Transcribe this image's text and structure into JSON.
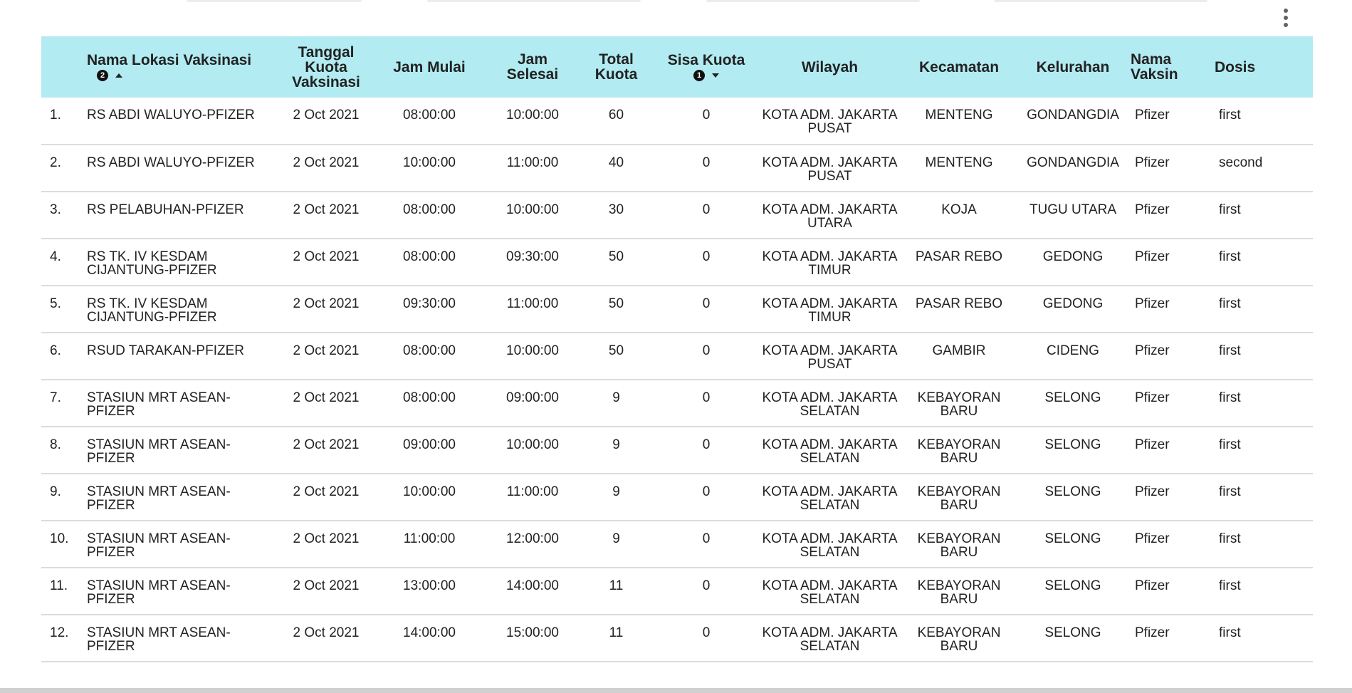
{
  "table": {
    "columns": {
      "nama_lokasi": "Nama Lokasi Vaksinasi",
      "nama_lokasi_sort_order": "2",
      "tanggal": "Tanggal Kuota Vaksinasi",
      "jam_mulai": "Jam Mulai",
      "jam_selesai": "Jam Selesai",
      "total_kuota": "Total Kuota",
      "sisa_kuota": "Sisa Kuota",
      "sisa_kuota_sort_order": "1",
      "wilayah": "Wilayah",
      "kecamatan": "Kecamatan",
      "kelurahan": "Kelurahan",
      "nama_vaksin": "Nama Vaksin",
      "dosis": "Dosis"
    },
    "rows": [
      {
        "no": "1.",
        "lokasi": "RS ABDI WALUYO-PFIZER",
        "tanggal": "2 Oct 2021",
        "mulai": "08:00:00",
        "selesai": "10:00:00",
        "total": "60",
        "sisa": "0",
        "wilayah": "KOTA ADM. JAKARTA PUSAT",
        "kecamatan": "MENTENG",
        "kelurahan": "GONDANGDIA",
        "vaksin": "Pfizer",
        "dosis": "first"
      },
      {
        "no": "2.",
        "lokasi": "RS ABDI WALUYO-PFIZER",
        "tanggal": "2 Oct 2021",
        "mulai": "10:00:00",
        "selesai": "11:00:00",
        "total": "40",
        "sisa": "0",
        "wilayah": "KOTA ADM. JAKARTA PUSAT",
        "kecamatan": "MENTENG",
        "kelurahan": "GONDANGDIA",
        "vaksin": "Pfizer",
        "dosis": "second"
      },
      {
        "no": "3.",
        "lokasi": "RS PELABUHAN-PFIZER",
        "tanggal": "2 Oct 2021",
        "mulai": "08:00:00",
        "selesai": "10:00:00",
        "total": "30",
        "sisa": "0",
        "wilayah": "KOTA ADM. JAKARTA UTARA",
        "kecamatan": "KOJA",
        "kelurahan": "TUGU UTARA",
        "vaksin": "Pfizer",
        "dosis": "first"
      },
      {
        "no": "4.",
        "lokasi": "RS TK. IV KESDAM CIJANTUNG-PFIZER",
        "tanggal": "2 Oct 2021",
        "mulai": "08:00:00",
        "selesai": "09:30:00",
        "total": "50",
        "sisa": "0",
        "wilayah": "KOTA ADM. JAKARTA TIMUR",
        "kecamatan": "PASAR REBO",
        "kelurahan": "GEDONG",
        "vaksin": "Pfizer",
        "dosis": "first"
      },
      {
        "no": "5.",
        "lokasi": "RS TK. IV KESDAM CIJANTUNG-PFIZER",
        "tanggal": "2 Oct 2021",
        "mulai": "09:30:00",
        "selesai": "11:00:00",
        "total": "50",
        "sisa": "0",
        "wilayah": "KOTA ADM. JAKARTA TIMUR",
        "kecamatan": "PASAR REBO",
        "kelurahan": "GEDONG",
        "vaksin": "Pfizer",
        "dosis": "first"
      },
      {
        "no": "6.",
        "lokasi": "RSUD TARAKAN-PFIZER",
        "tanggal": "2 Oct 2021",
        "mulai": "08:00:00",
        "selesai": "10:00:00",
        "total": "50",
        "sisa": "0",
        "wilayah": "KOTA ADM. JAKARTA PUSAT",
        "kecamatan": "GAMBIR",
        "kelurahan": "CIDENG",
        "vaksin": "Pfizer",
        "dosis": "first"
      },
      {
        "no": "7.",
        "lokasi": "STASIUN MRT ASEAN-PFIZER",
        "tanggal": "2 Oct 2021",
        "mulai": "08:00:00",
        "selesai": "09:00:00",
        "total": "9",
        "sisa": "0",
        "wilayah": "KOTA ADM. JAKARTA SELATAN",
        "kecamatan": "KEBAYORAN BARU",
        "kelurahan": "SELONG",
        "vaksin": "Pfizer",
        "dosis": "first"
      },
      {
        "no": "8.",
        "lokasi": "STASIUN MRT ASEAN-PFIZER",
        "tanggal": "2 Oct 2021",
        "mulai": "09:00:00",
        "selesai": "10:00:00",
        "total": "9",
        "sisa": "0",
        "wilayah": "KOTA ADM. JAKARTA SELATAN",
        "kecamatan": "KEBAYORAN BARU",
        "kelurahan": "SELONG",
        "vaksin": "Pfizer",
        "dosis": "first"
      },
      {
        "no": "9.",
        "lokasi": "STASIUN MRT ASEAN-PFIZER",
        "tanggal": "2 Oct 2021",
        "mulai": "10:00:00",
        "selesai": "11:00:00",
        "total": "9",
        "sisa": "0",
        "wilayah": "KOTA ADM. JAKARTA SELATAN",
        "kecamatan": "KEBAYORAN BARU",
        "kelurahan": "SELONG",
        "vaksin": "Pfizer",
        "dosis": "first"
      },
      {
        "no": "10.",
        "lokasi": "STASIUN MRT ASEAN-PFIZER",
        "tanggal": "2 Oct 2021",
        "mulai": "11:00:00",
        "selesai": "12:00:00",
        "total": "9",
        "sisa": "0",
        "wilayah": "KOTA ADM. JAKARTA SELATAN",
        "kecamatan": "KEBAYORAN BARU",
        "kelurahan": "SELONG",
        "vaksin": "Pfizer",
        "dosis": "first"
      },
      {
        "no": "11.",
        "lokasi": "STASIUN MRT ASEAN-PFIZER",
        "tanggal": "2 Oct 2021",
        "mulai": "13:00:00",
        "selesai": "14:00:00",
        "total": "11",
        "sisa": "0",
        "wilayah": "KOTA ADM. JAKARTA SELATAN",
        "kecamatan": "KEBAYORAN BARU",
        "kelurahan": "SELONG",
        "vaksin": "Pfizer",
        "dosis": "first"
      },
      {
        "no": "12.",
        "lokasi": "STASIUN MRT ASEAN-PFIZER",
        "tanggal": "2 Oct 2021",
        "mulai": "14:00:00",
        "selesai": "15:00:00",
        "total": "11",
        "sisa": "0",
        "wilayah": "KOTA ADM. JAKARTA SELATAN",
        "kecamatan": "KEBAYORAN BARU",
        "kelurahan": "SELONG",
        "vaksin": "Pfizer",
        "dosis": "first"
      }
    ]
  },
  "colors": {
    "header_background": "#b2ebf2",
    "row_divider": "#dcdcdc"
  },
  "icons": {
    "menu": "more-vert-icon",
    "sort_asc": "sort-ascending-icon",
    "sort_desc": "sort-descending-icon"
  }
}
